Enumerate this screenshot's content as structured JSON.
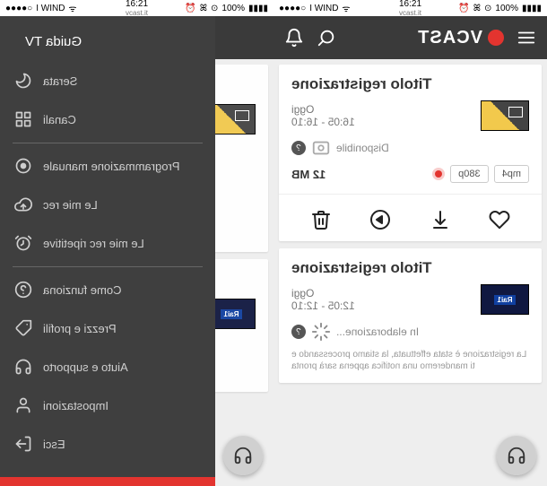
{
  "statusbar": {
    "carrier": "I WIND",
    "time": "16:21",
    "site": "vcast.it",
    "battery": "100%"
  },
  "app": {
    "name": "VCAST"
  },
  "drawer": {
    "header": "Guida TV",
    "items": [
      "Serata",
      "Canali",
      "Programmazione manuale",
      "Le mie rec",
      "Le mie rec ripetitive",
      "Come funziona",
      "Prezzi e profili",
      "Aiuto e supporto",
      "Impostazioni",
      "Esci"
    ]
  },
  "cards": [
    {
      "title": "Titolo registrazione",
      "day": "Oggi",
      "time": "16:05 - 16:10",
      "status": "Disponibile",
      "format": "mp4",
      "quality": "380p",
      "size": "12 MB"
    },
    {
      "title": "Titolo registrazione",
      "day": "Oggi",
      "time": "12:05 - 12:10",
      "status": "In elaborazione...",
      "msg": "La registrazione è stata effettuata, la stiamo processando e ti manderemo una notifica appena sarà pronta",
      "channel": "Rai1"
    }
  ]
}
